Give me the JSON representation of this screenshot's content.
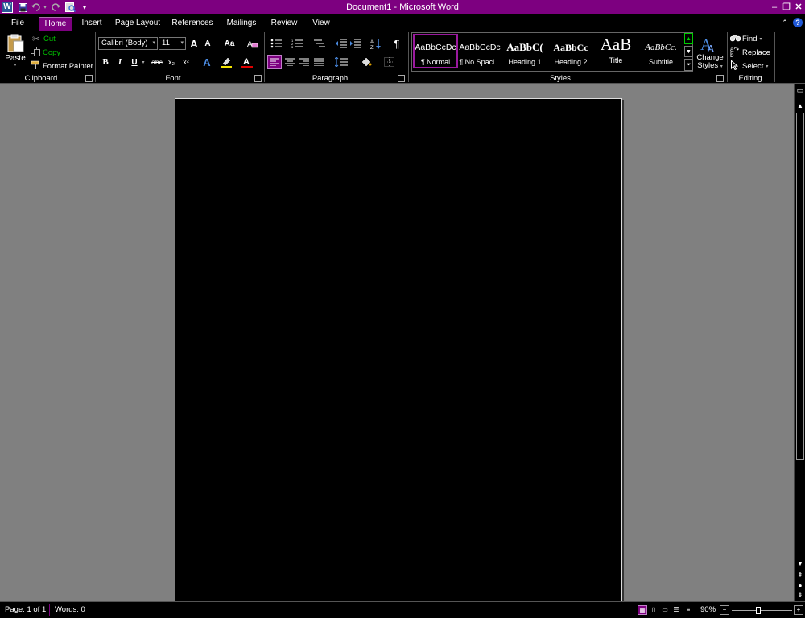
{
  "window": {
    "title": "Document1  -  Microsoft Word",
    "accent_color": "#7d0080",
    "app_icon_letter": "W"
  },
  "qat": {
    "save_icon": "save-icon",
    "undo_icon": "undo-icon",
    "redo_icon": "redo-icon",
    "print_preview_icon": "print-preview-icon",
    "customize_icon": "customize-qat-icon"
  },
  "tabs": [
    {
      "label": "File"
    },
    {
      "label": "Home"
    },
    {
      "label": "Insert"
    },
    {
      "label": "Page Layout"
    },
    {
      "label": "References"
    },
    {
      "label": "Mailings"
    },
    {
      "label": "Review"
    },
    {
      "label": "View"
    }
  ],
  "active_tab": "Home",
  "ribbon": {
    "clipboard": {
      "label": "Clipboard",
      "paste": "Paste",
      "cut": "Cut",
      "copy": "Copy",
      "format_painter": "Format Painter",
      "cut_color": "#00c000",
      "copy_color": "#00c000"
    },
    "font": {
      "label": "Font",
      "font_name": "Calibri (Body)",
      "font_size": "11",
      "bold": "B",
      "italic": "I",
      "underline": "U",
      "strike": "abc",
      "subscript": "x₂",
      "superscript": "x²",
      "grow": "A",
      "shrink": "A",
      "change_case": "Aa",
      "text_effect": "A",
      "font_color": "A"
    },
    "paragraph": {
      "label": "Paragraph",
      "pilcrow": "¶"
    },
    "styles": {
      "label": "Styles",
      "items": [
        {
          "sample": "AaBbCcDc",
          "name": "¶ Normal"
        },
        {
          "sample": "AaBbCcDc",
          "name": "¶ No Spaci..."
        },
        {
          "sample": "AaBbC(",
          "name": "Heading 1"
        },
        {
          "sample": "AaBbCc",
          "name": "Heading 2"
        },
        {
          "sample": "AaB",
          "name": "Title"
        },
        {
          "sample": "AaBbCc.",
          "name": "Subtitle"
        }
      ],
      "change_styles_line1": "Change",
      "change_styles_line2": "Styles"
    },
    "editing": {
      "label": "Editing",
      "find": "Find",
      "replace": "Replace",
      "select": "Select"
    }
  },
  "status": {
    "page": "Page: 1 of 1",
    "words": "Words: 0",
    "zoom": "90%",
    "zoom_level_percent": 90
  }
}
